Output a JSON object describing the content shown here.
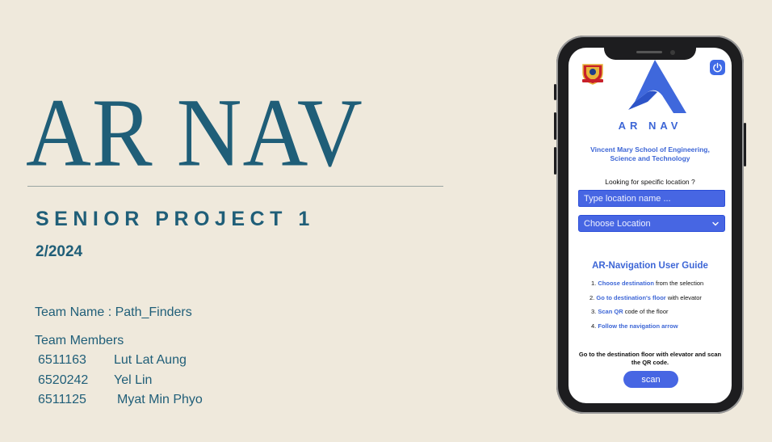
{
  "slide": {
    "title": "AR NAV",
    "subtitle": "SENIOR PROJECT 1",
    "term": "2/2024",
    "team_name": "Team Name : Path_Finders",
    "team_members_label": "Team Members",
    "members": [
      {
        "id": "6511163",
        "name": "Lut Lat Aung"
      },
      {
        "id": "6520242",
        "name": "Yel Lin"
      },
      {
        "id": "6511125",
        "name": "Myat Min Phyo"
      }
    ]
  },
  "app": {
    "name": "AR NAV",
    "school": "Vincent Mary School of Engineering, Science and Technology",
    "looking_prompt": "Looking for specific location ?",
    "search_placeholder": "Type location name ...",
    "select_value": "Choose Location",
    "guide": {
      "title": "AR-Navigation User Guide",
      "items": [
        {
          "num": "1.",
          "link": "Choose destination",
          "rest": " from the selection"
        },
        {
          "num": "2.",
          "link": "Go to destination's floor",
          "rest": " with elevator"
        },
        {
          "num": "3.",
          "link": "Scan QR",
          "rest": " code of the floor"
        },
        {
          "num": "4.",
          "link": "Follow the navigation arrow",
          "rest": ""
        }
      ]
    },
    "instruction": "Go to the destination floor with elevator and scan the QR code.",
    "scan_label": "scan",
    "icons": {
      "power": "power-icon",
      "dropdown": "chevron-down-icon",
      "logo": "ar-nav-logo-icon",
      "school": "school-emblem-icon"
    },
    "colors": {
      "accent": "#3d66d6",
      "input": "#4766e3",
      "title": "#1f5e78",
      "background": "#efe9dc"
    }
  }
}
